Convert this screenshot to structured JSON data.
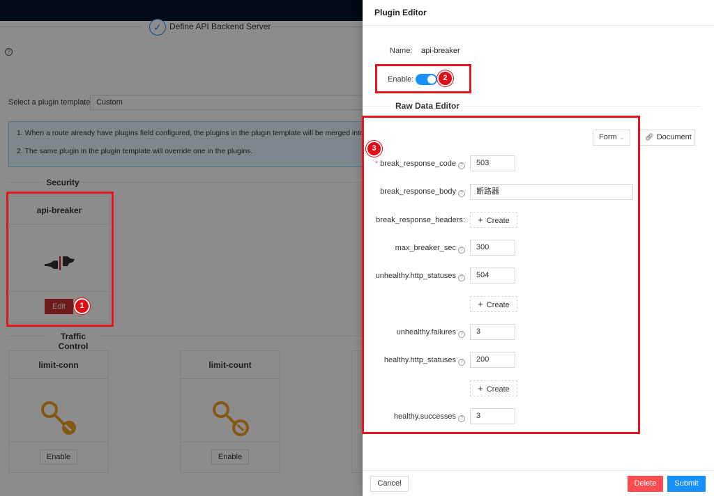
{
  "steps": {
    "current_title": "Define API Backend Server"
  },
  "template": {
    "label": "Select a plugin template :",
    "value": "Custom"
  },
  "info": {
    "line1": "1. When a route already have plugins field configured, the plugins in the plugin template will be merged into it.",
    "line2": "2. The same plugin in the plugin template will override one in the plugins."
  },
  "sections": {
    "security": "Security",
    "traffic": "Traffic Control"
  },
  "cards": {
    "api_breaker": {
      "title": "api-breaker",
      "button": "Edit"
    },
    "limit_conn": {
      "title": "limit-conn",
      "button": "Enable"
    },
    "limit_count": {
      "title": "limit-count",
      "button": "Enable"
    }
  },
  "drawer": {
    "title": "Plugin Editor",
    "name_label": "Name:",
    "name_value": "api-breaker",
    "enable_label": "Enable:",
    "enabled": true,
    "raw_title": "Raw Data Editor",
    "form_select": "Form",
    "document_button": "Document",
    "cancel": "Cancel",
    "delete": "Delete",
    "submit": "Submit"
  },
  "form": {
    "create_label": "Create",
    "fields": {
      "break_response_code": {
        "label": "break_response_code",
        "value": "503"
      },
      "break_response_body": {
        "label": "break_response_body",
        "value": "断路器"
      },
      "break_response_headers": {
        "label": "break_response_headers"
      },
      "max_breaker_sec": {
        "label": "max_breaker_sec",
        "value": "300"
      },
      "unhealthy_http_statuses": {
        "label": "unhealthy.http_statuses",
        "value": "504"
      },
      "unhealthy_failures": {
        "label": "unhealthy.failures",
        "value": "3"
      },
      "healthy_http_statuses": {
        "label": "healthy.http_statuses",
        "value": "200"
      },
      "healthy_successes": {
        "label": "healthy.successes",
        "value": "3"
      }
    }
  },
  "annotations": {
    "m1": "1",
    "m2": "2",
    "m3": "3"
  },
  "colors": {
    "primary": "#1890ff",
    "danger": "#ff4d4f",
    "highlight": "#e8141e",
    "topbar": "#001529"
  },
  "icons": {
    "breaker": "plug-breaker-icon",
    "limit": "key-limit-icon",
    "check": "check-icon",
    "link": "link-icon",
    "help": "question-circle-icon"
  }
}
